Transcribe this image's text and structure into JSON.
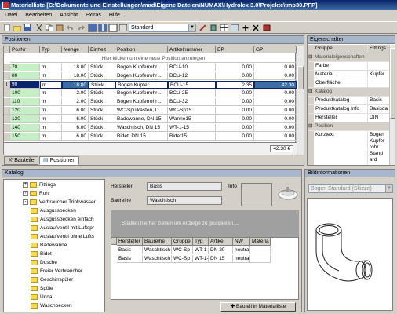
{
  "window": {
    "title": "Materialliste [C:\\Dokumente und Einstellungen\\mad\\Eigene Dateien\\NUMAX\\Hydrolex 3.0\\Projekte\\tmp30.PFP]"
  },
  "menu": [
    "Datei",
    "Bearbeiten",
    "Ansicht",
    "Extras",
    "Hilfe"
  ],
  "toolbar": {
    "style_value": "Standard"
  },
  "positions": {
    "header": "Positionen",
    "columns": [
      "PosNr",
      "Typ",
      "Menge",
      "Einheit",
      "Position",
      "Artikelnummer",
      "EP",
      "GP"
    ],
    "new_row_hint": "Hier klicken um eine neue Position anzulegen",
    "rows": [
      [
        "70",
        "m",
        "18.00",
        "Stück",
        "Bogen Kupferrohr ...",
        "BCU-10",
        "0.00",
        "0.00"
      ],
      [
        "80",
        "m",
        "18.00",
        "Stück",
        "Bogen Kupferrohr ...",
        "BCU-12",
        "0.00",
        "0.00"
      ],
      [
        "90",
        "m",
        "18.00",
        "Stück",
        "Bogen Kupfer...",
        "BCU-15",
        "2.35",
        "42.30"
      ],
      [
        "100",
        "m",
        "2.00",
        "Stück",
        "Bogen Kupferrohr ...",
        "BCU-25",
        "0.00",
        "0.00"
      ],
      [
        "110",
        "m",
        "2.00",
        "Stück",
        "Bogen Kupferrohr ...",
        "BCU-32",
        "0.00",
        "0.00"
      ],
      [
        "120",
        "m",
        "6.00",
        "Stück",
        "WC-Spülkasten, D...",
        "WC-Sp15",
        "0.00",
        "0.00"
      ],
      [
        "130",
        "m",
        "6.00",
        "Stück",
        "Badewanne, DN 15",
        "Wanne15",
        "0.00",
        "0.00"
      ],
      [
        "140",
        "m",
        "6.00",
        "Stück",
        "Waschtisch, DN 15",
        "WT-1-15",
        "0.00",
        "0.00"
      ],
      [
        "150",
        "m",
        "6.00",
        "Stück",
        "Bidet, DN 15",
        "Bidet15",
        "0.00",
        "0.00"
      ]
    ],
    "total": "42.30 €",
    "tabs": [
      "Bauteile",
      "Positionen"
    ]
  },
  "properties": {
    "header": "Eigenschaften",
    "rows": [
      {
        "label": "Gruppe",
        "value": "Fittings",
        "kind": "prop"
      },
      {
        "label": "Materialeigenschaften",
        "value": "",
        "kind": "section"
      },
      {
        "label": "Farbe",
        "value": "",
        "kind": "prop"
      },
      {
        "label": "Material",
        "value": "Kupfer",
        "kind": "prop"
      },
      {
        "label": "Oberfläche",
        "value": "",
        "kind": "prop"
      },
      {
        "label": "Katalog",
        "value": "",
        "kind": "section"
      },
      {
        "label": "Produktkatalog",
        "value": "Basis",
        "kind": "prop"
      },
      {
        "label": "Produktkatalog Info",
        "value": "Basisda",
        "kind": "prop"
      },
      {
        "label": "Hersteller",
        "value": "DIN",
        "kind": "prop"
      },
      {
        "label": "Position",
        "value": "",
        "kind": "section"
      },
      {
        "label": "Kurztext",
        "value": "Bogen\nKupfer\nrohr\nStand\nard",
        "kind": "prop"
      }
    ]
  },
  "catalog": {
    "header": "Katalog",
    "tree": [
      {
        "label": "Fittings",
        "level": 0,
        "expander": "+"
      },
      {
        "label": "Rohr",
        "level": 0,
        "expander": "+"
      },
      {
        "label": "Verbraucher Trinkwasser",
        "level": 0,
        "expander": "-"
      },
      {
        "label": "Ausgussbecken",
        "level": 1
      },
      {
        "label": "Ausgussbecken einfach",
        "level": 1
      },
      {
        "label": "Auslaufventil mit Luftspr",
        "level": 1
      },
      {
        "label": "Auslaufventil ohne Lufts",
        "level": 1
      },
      {
        "label": "Badewanne",
        "level": 1
      },
      {
        "label": "Bidet",
        "level": 1
      },
      {
        "label": "Dusche",
        "level": 1
      },
      {
        "label": "Freier Verbraucher",
        "level": 1
      },
      {
        "label": "Geschirrspüler",
        "level": 1
      },
      {
        "label": "Spüle",
        "level": 1
      },
      {
        "label": "Urinal",
        "level": 1
      },
      {
        "label": "Waschbecken",
        "level": 1
      }
    ],
    "hersteller_label": "Hersteller",
    "hersteller_value": "Basis",
    "baureihe_label": "Baureihe",
    "baureihe_value": "Waschtisch",
    "info_label": "Info",
    "group_hint": "Spalten hierher ziehen um Anzeige zu gruppieren....",
    "columns": [
      "Hersteller",
      "Baureihe",
      "Gruppe",
      "Typ",
      "Artikel",
      "NW",
      "Materia"
    ],
    "rows": [
      [
        "Basis",
        "Waschtisch",
        "WC-Sp",
        "WT-1-20",
        "DN 20",
        "neutral",
        ""
      ],
      [
        "Basis",
        "Waschtisch",
        "WC-Sp",
        "WT-1-15",
        "DN 15",
        "neutral",
        ""
      ]
    ],
    "add_button": "Bauteil in Materialliste"
  },
  "bildinfo": {
    "header": "Bildinformationen",
    "select_value": "Bogen Standard (Skizze)"
  },
  "colors": {
    "title": "#0a246a",
    "selected": "#0a246a",
    "panel_header": "#a9b7cc",
    "green": "#c6efc6"
  }
}
